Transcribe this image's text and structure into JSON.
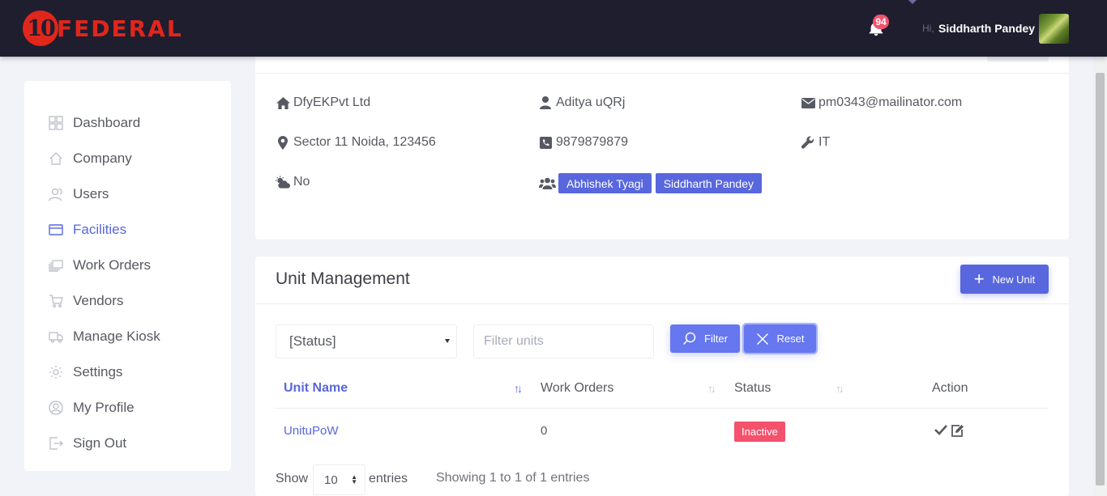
{
  "header": {
    "logo_number": "10",
    "logo_text": "FEDERAL",
    "notification_count": "94",
    "greeting": "Hi,",
    "user_name": "Siddharth Pandey"
  },
  "sidebar": {
    "items": [
      {
        "label": "Dashboard",
        "icon": "grid-icon"
      },
      {
        "label": "Company",
        "icon": "home-icon"
      },
      {
        "label": "Users",
        "icon": "users-icon"
      },
      {
        "label": "Facilities",
        "icon": "card-icon",
        "active": true
      },
      {
        "label": "Work Orders",
        "icon": "layers-icon"
      },
      {
        "label": "Vendors",
        "icon": "cart-icon"
      },
      {
        "label": "Manage Kiosk",
        "icon": "truck-icon"
      },
      {
        "label": "Settings",
        "icon": "gear-icon"
      },
      {
        "label": "My Profile",
        "icon": "profile-icon"
      },
      {
        "label": "Sign Out",
        "icon": "sign-out-icon"
      }
    ]
  },
  "facility": {
    "company": "DfyEKPvt Ltd",
    "contact": "Aditya uQRj",
    "email": "pm0343@mailinator.com",
    "address": "Sector 11 Noida, 123456",
    "phone": "9879879879",
    "category": "IT",
    "weather": "No",
    "managers": [
      "Abhishek Tyagi",
      "Siddharth Pandey"
    ]
  },
  "units": {
    "title": "Unit Management",
    "new_button": "New Unit",
    "status_select": "[Status]",
    "filter_placeholder": "Filter units",
    "filter_button": "Filter",
    "reset_button": "Reset",
    "columns": [
      "Unit Name",
      "Work Orders",
      "Status",
      "Action"
    ],
    "rows": [
      {
        "name": "UnituPoW",
        "work_orders": "0",
        "status": "Inactive"
      }
    ],
    "show_label": "Show",
    "page_length": "10",
    "entries_label": "entries",
    "info": "Showing 1 to 1 of 1 entries"
  },
  "colors": {
    "accent": "#5867dd",
    "topbar": "#1f1e2e",
    "danger": "#f4516c",
    "logo_red": "#e1261c"
  }
}
